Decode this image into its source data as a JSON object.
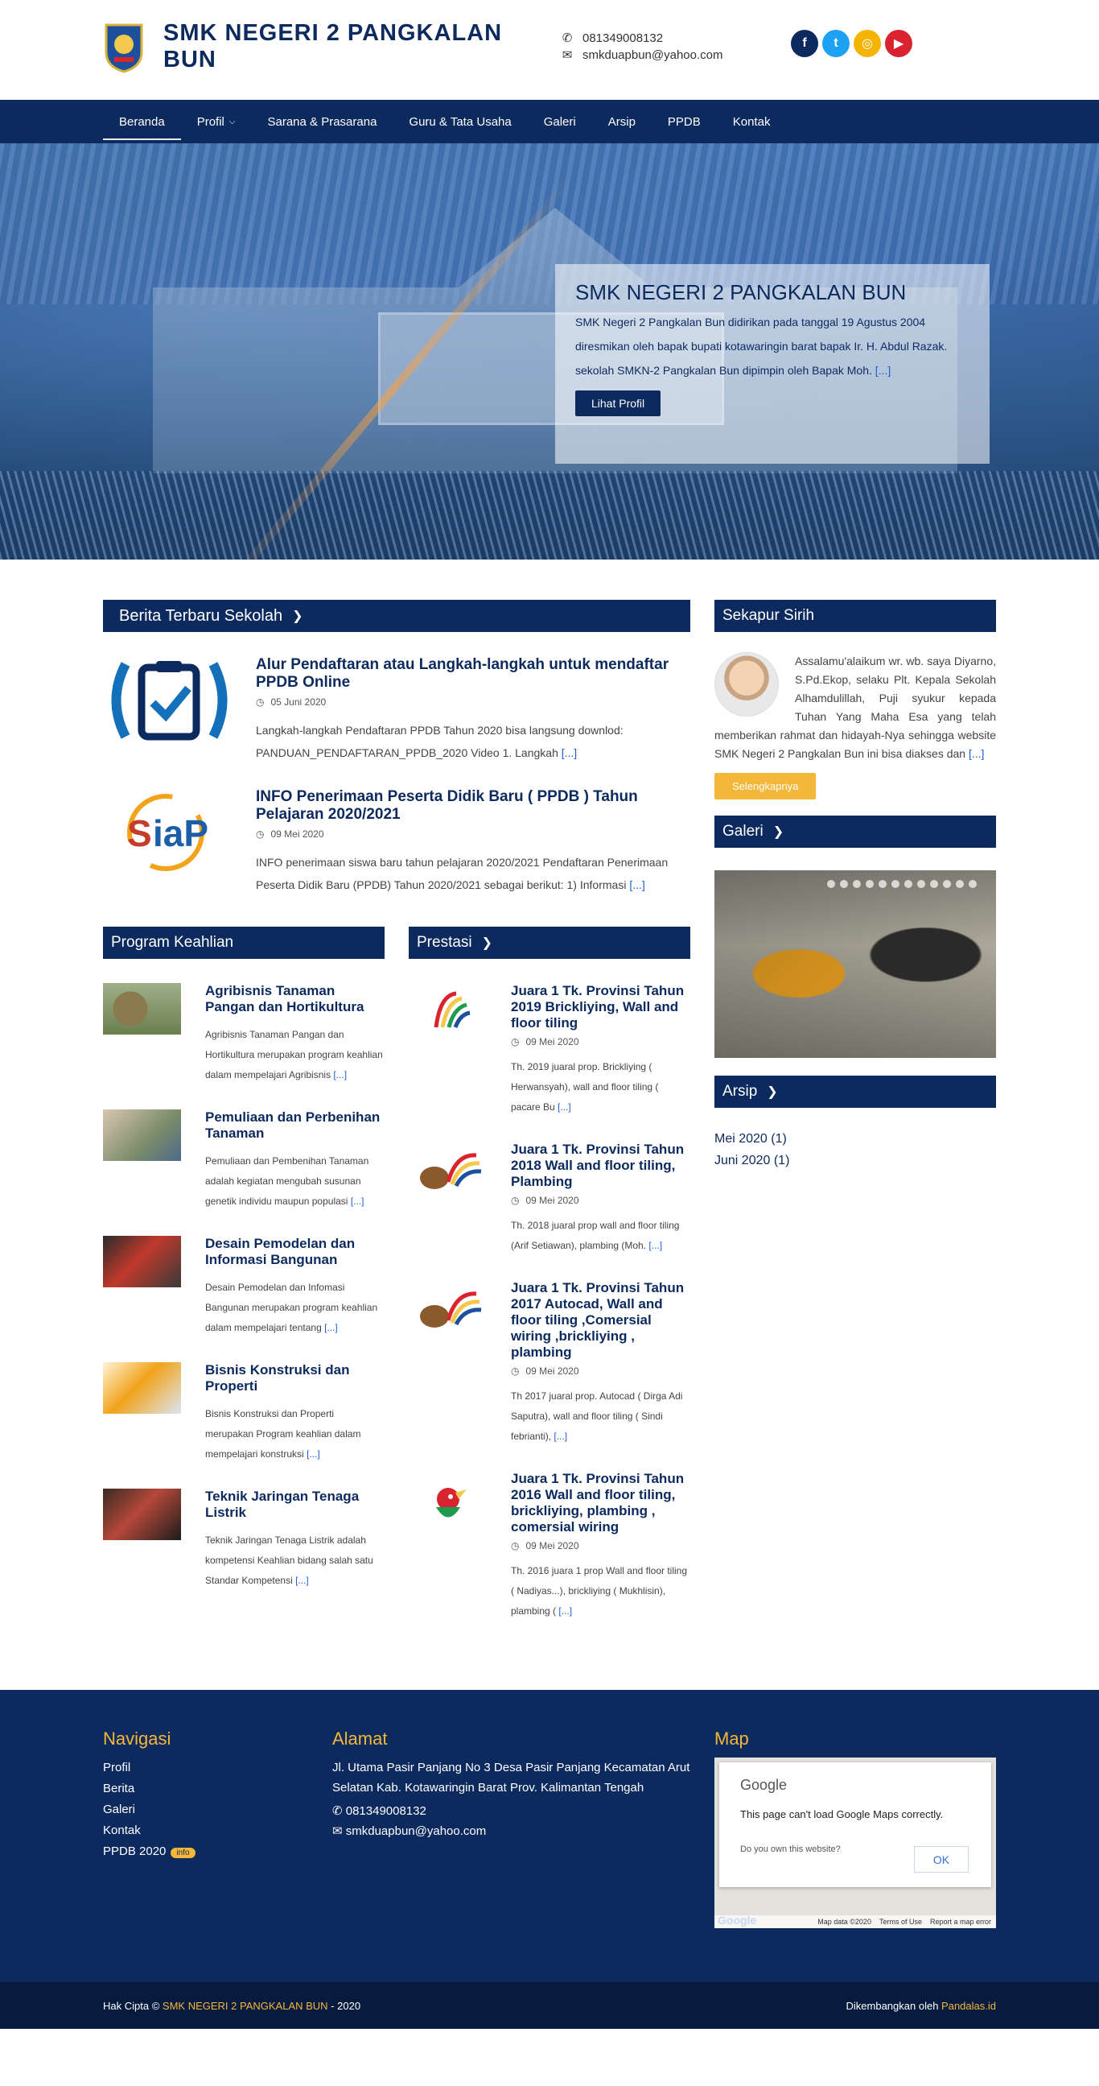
{
  "header": {
    "site_title": "SMK NEGERI 2 PANGKALAN BUN",
    "phone": "081349008132",
    "email": "smkduapbun@yahoo.com",
    "socials": [
      {
        "name": "facebook",
        "glyph": "f"
      },
      {
        "name": "twitter",
        "glyph": "t"
      },
      {
        "name": "instagram",
        "glyph": "◎"
      },
      {
        "name": "youtube",
        "glyph": "▶"
      }
    ]
  },
  "nav": {
    "items": [
      {
        "label": "Beranda"
      },
      {
        "label": "Profil"
      },
      {
        "label": "Sarana & Prasarana"
      },
      {
        "label": "Guru & Tata Usaha"
      },
      {
        "label": "Galeri"
      },
      {
        "label": "Arsip"
      },
      {
        "label": "PPDB"
      },
      {
        "label": "Kontak"
      }
    ]
  },
  "hero": {
    "title": "SMK NEGERI 2 PANGKALAN BUN",
    "text": "SMK Negeri 2 Pangkalan Bun  didirikan pada tanggal 19 Agustus 2004 diresmikan oleh bapak bupati kotawaringin barat bapak Ir. H. Abdul Razak. sekolah SMKN-2 Pangkalan Bun dipimpin oleh Bapak Moh.",
    "more": "[...]",
    "button": "Lihat Profil"
  },
  "news": {
    "heading": "Berita Terbaru Sekolah",
    "items": [
      {
        "title": "Alur Pendaftaran atau Langkah-langkah untuk mendaftar PPDB Online",
        "date": "05 Juni 2020",
        "excerpt": " Langkah-langkah Pendaftaran PPDB Tahun 2020 bisa langsung downlod: PANDUAN_PENDAFTARAN_PPDB_2020 Video 1. Langkah",
        "more": "[...]"
      },
      {
        "title": "INFO Penerimaan Peserta Didik Baru ( PPDB ) Tahun Pelajaran 2020/2021",
        "date": "09 Mei 2020",
        "excerpt": "INFO penerimaan siswa baru tahun pelajaran 2020/2021 Pendaftaran Penerimaan Peserta Didik Baru (PPDB) Tahun 2020/2021 sebagai berikut: 1) Informasi",
        "more": "[...]"
      }
    ]
  },
  "program": {
    "heading": "Program Keahlian",
    "items": [
      {
        "title": "Agribisnis Tanaman Pangan dan Hortikultura",
        "text": "Agribisnis Tanaman Pangan dan Hortikultura merupakan program keahlian dalam mempelajari Agribisnis",
        "more": "[...]"
      },
      {
        "title": "Pemuliaan dan Perbenihan Tanaman",
        "text": "Pemuliaan dan Pembenihan Tanaman adalah kegiatan mengubah susunan genetik individu maupun populasi",
        "more": "[...]"
      },
      {
        "title": "Desain Pemodelan dan Informasi Bangunan",
        "text": "Desain Pemodelan dan Infomasi Bangunan merupakan program keahlian dalam mempelajari tentang",
        "more": "[...]"
      },
      {
        "title": "Bisnis Konstruksi dan Properti",
        "text": "Bisnis Konstruksi dan Properti merupakan Program keahlian dalam mempelajari  konstruksi",
        "more": "[...]"
      },
      {
        "title": "Teknik Jaringan Tenaga Listrik",
        "text": "Teknik Jaringan Tenaga Listrik adalah kompetensi Keahlian bidang salah satu Standar Kompetensi",
        "more": "[...]"
      }
    ]
  },
  "prestasi": {
    "heading": "Prestasi",
    "items": [
      {
        "title": "Juara 1 Tk. Provinsi Tahun 2019 Brickliying, Wall and floor tiling",
        "date": "09 Mei 2020",
        "text": "Th. 2019 juaral prop. Brickliying ( Herwansyah), wall and floor tiling ( pacare Bu",
        "more": "[...]"
      },
      {
        "title": "Juara 1 Tk. Provinsi Tahun 2018 Wall and floor tiling, Plambing",
        "date": "09 Mei 2020",
        "text": "Th. 2018 juaral prop wall and floor tiling (Arif Setiawan), plambing (Moh.",
        "more": "[...]"
      },
      {
        "title": "Juara 1 Tk. Provinsi Tahun 2017 Autocad, Wall and floor tiling ,Comersial wiring ,brickliying , plambing",
        "date": "09 Mei 2020",
        "text": "Th 2017 juaral prop. Autocad ( Dirga Adi Saputra), wall and floor tiling ( Sindi febrianti),",
        "more": "[...]"
      },
      {
        "title": "Juara 1 Tk. Provinsi Tahun 2016 Wall and floor tiling, brickliying, plambing , comersial wiring",
        "date": "09 Mei 2020",
        "text": "Th. 2016 juara 1 prop Wall and floor tiling ( Nadiyas...), brickliying ( Mukhlisin), plambing (",
        "more": "[...]"
      }
    ]
  },
  "sidebar": {
    "sekapur_heading": "Sekapur Sirih",
    "sekapur_text": "Assalamu'alaikum wr. wb. saya Diyarno, S.Pd.Ekop, selaku Plt. Kepala Sekolah Alhamdulillah, Puji syukur kepada Tuhan Yang Maha Esa yang telah memberikan rahmat dan hidayah-Nya sehingga website SMK Negeri 2 Pangkalan Bun ini bisa diakses dan",
    "sekapur_more": "[...]",
    "sekapur_button": "Selengkapnya",
    "galeri_heading": "Galeri",
    "arsip_heading": "Arsip",
    "arsip_items": [
      "Mei 2020 (1)",
      "Juni 2020 (1)"
    ]
  },
  "footer": {
    "nav_heading": "Navigasi",
    "nav_links": [
      "Profil",
      "Berita",
      "Galeri",
      "Kontak",
      "PPDB 2020"
    ],
    "nav_badge": "info",
    "address_heading": "Alamat",
    "address": "Jl. Utama Pasir Panjang No 3 Desa Pasir Panjang Kecamatan Arut Selatan Kab. Kotawaringin Barat Prov. Kalimantan Tengah",
    "phone": "081349008132",
    "email": "smkduapbun@yahoo.com",
    "map_heading": "Map",
    "map": {
      "logo": "Google",
      "error": "This page can't load Google Maps correctly.",
      "question": "Do you own this website?",
      "ok": "OK",
      "footer_data": "Map data ©2020",
      "footer_terms": "Terms of Use",
      "footer_report": "Report a map error"
    }
  },
  "copyright": {
    "prefix": "Hak Cipta ©",
    "name": "SMK NEGERI 2 PANGKALAN BUN",
    "suffix": "- 2020",
    "dev_prefix": "Dikembangkan oleh",
    "dev_name": "Pandalas.id"
  },
  "colors": {
    "primary": "#0c2a5e",
    "accent": "#f4b73a",
    "link": "#1a5fd1"
  }
}
